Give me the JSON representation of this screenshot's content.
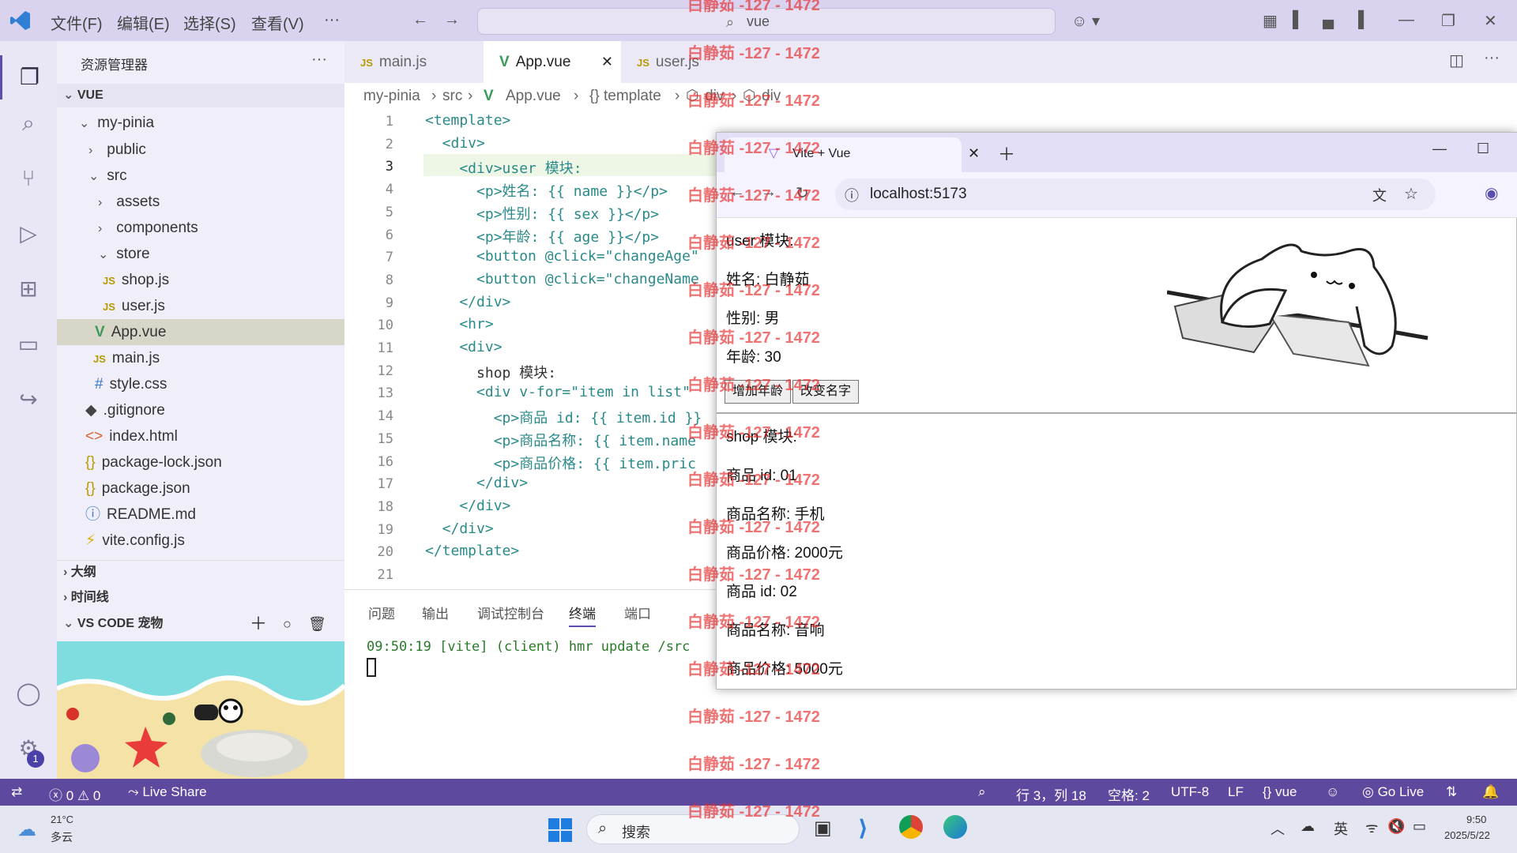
{
  "titlebar": {
    "menus": [
      "文件(F)",
      "编辑(E)",
      "选择(S)",
      "查看(V)",
      "···"
    ],
    "search_text": "vue"
  },
  "sidebar": {
    "title": "资源管理器",
    "more": "···",
    "root": "VUE",
    "tree": [
      {
        "label": "my-pinia",
        "type": "folder-open"
      },
      {
        "label": "public",
        "type": "folder"
      },
      {
        "label": "src",
        "type": "folder-open"
      },
      {
        "label": "assets",
        "type": "folder"
      },
      {
        "label": "components",
        "type": "folder"
      },
      {
        "label": "store",
        "type": "folder-open"
      },
      {
        "label": "shop.js",
        "type": "js"
      },
      {
        "label": "user.js",
        "type": "js"
      },
      {
        "label": "App.vue",
        "type": "vue"
      },
      {
        "label": "main.js",
        "type": "js"
      },
      {
        "label": "style.css",
        "type": "css"
      },
      {
        "label": ".gitignore",
        "type": "git"
      },
      {
        "label": "index.html",
        "type": "html"
      },
      {
        "label": "package-lock.json",
        "type": "json"
      },
      {
        "label": "package.json",
        "type": "json"
      },
      {
        "label": "README.md",
        "type": "info"
      },
      {
        "label": "vite.config.js",
        "type": "vite"
      }
    ],
    "sections": {
      "outline": "大纲",
      "timeline": "时间线",
      "pet": "VS CODE 宠物"
    }
  },
  "tabs": [
    {
      "label": "main.js",
      "icon": "JS"
    },
    {
      "label": "App.vue",
      "icon": "V"
    },
    {
      "label": "user.js",
      "icon": "JS"
    }
  ],
  "breadcrumb": [
    "my-pinia",
    "src",
    "App.vue",
    "{} template",
    "div",
    "div"
  ],
  "editor": {
    "line_numbers": [
      "1",
      "2",
      "3",
      "4",
      "5",
      "6",
      "7",
      "8",
      "9",
      "10",
      "11",
      "12",
      "13",
      "14",
      "15",
      "16",
      "17",
      "18",
      "19",
      "20",
      "21"
    ],
    "lines": [
      "<template>",
      "  <div>",
      "    <div>user 模块:",
      "      <p>姓名: {{ name }}</p>",
      "      <p>性别: {{ sex }}</p>",
      "      <p>年龄: {{ age }}</p>",
      "      <button @click=\"changeAge\"",
      "      <button @click=\"changeName",
      "    </div>",
      "    <hr>",
      "    <div>",
      "      shop 模块:",
      "      <div v-for=\"item in list\"",
      "        <p>商品 id: {{ item.id }}",
      "        <p>商品名称: {{ item.name",
      "        <p>商品价格: {{ item.pric",
      "      </div>",
      "    </div>",
      "  </div>",
      "</template>",
      ""
    ]
  },
  "panel": {
    "tabs": [
      "问题",
      "输出",
      "调试控制台",
      "终端",
      "端口"
    ],
    "active_tab": "终端",
    "terminal_line": "09:50:19 [vite] (client) hmr update /src"
  },
  "statusbar": {
    "errors": "0",
    "warnings": "0",
    "live_share": "Live Share",
    "position": "行 3，列 18",
    "spaces": "空格: 2",
    "encoding": "UTF-8",
    "eol": "LF",
    "language": "vue",
    "go_live": "Go Live"
  },
  "browser": {
    "tab_title": "Vite + Vue",
    "url": "localhost:5173",
    "user_module": "user 模块:",
    "name": "姓名: 白静茹",
    "sex": "性别: 男",
    "age": "年龄: 30",
    "btn_age": "增加年龄",
    "btn_name": "改变名字",
    "shop_module": "shop 模块:",
    "items": [
      {
        "id": "商品 id: 01",
        "name": "商品名称: 手机",
        "price": "商品价格: 2000元"
      },
      {
        "id": "商品 id: 02",
        "name": "商品名称: 音响",
        "price": "商品价格: 5000元"
      }
    ]
  },
  "taskbar": {
    "weather_temp": "21°C",
    "weather_desc": "多云",
    "search": "搜索",
    "ime": "英",
    "time": "9:50",
    "date": "2025/5/22"
  },
  "watermark": "白静茹 -127 - 1472",
  "notification_badge": "1",
  "colors": {
    "accent": "#5d4a9e",
    "titlebar": "#d9d3f0"
  }
}
